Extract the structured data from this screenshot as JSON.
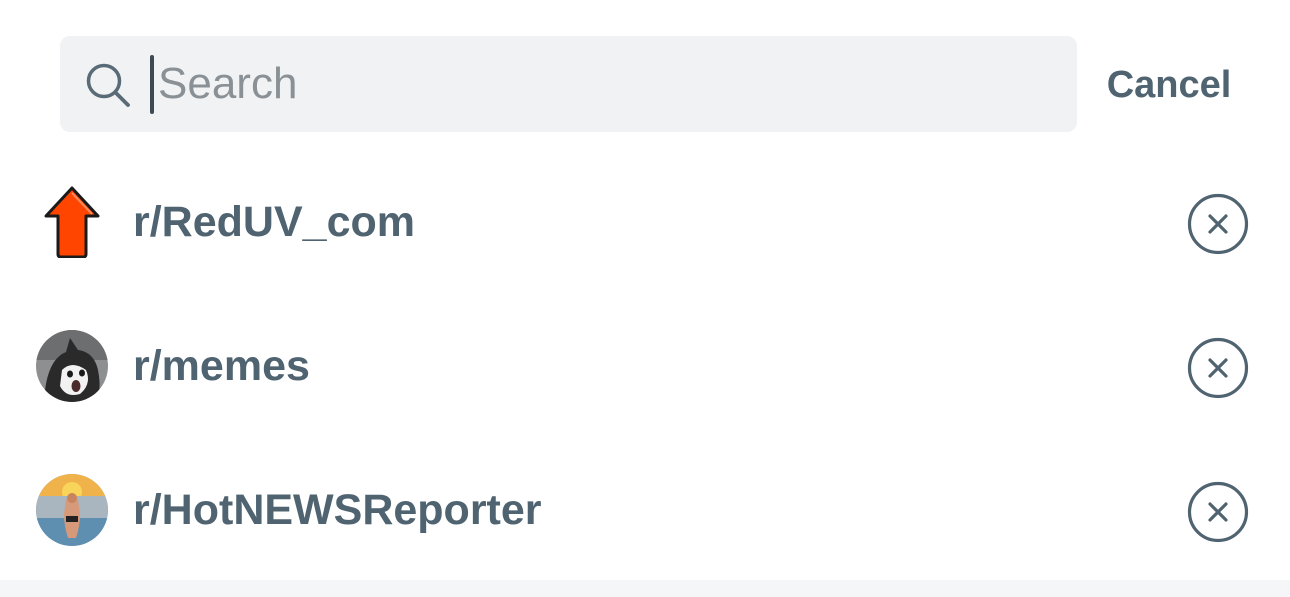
{
  "search": {
    "placeholder": "Search",
    "value": "",
    "cancel_label": "Cancel"
  },
  "recent_communities": [
    {
      "name": "r/RedUV_com",
      "icon": "red-up-arrow-icon"
    },
    {
      "name": "r/memes",
      "icon": "cat-avatar"
    },
    {
      "name": "r/HotNEWSReporter",
      "icon": "person-photo-avatar"
    }
  ],
  "colors": {
    "text": "#4f6370",
    "search_bg": "#f1f2f4",
    "accent_arrow": "#ff4500"
  }
}
